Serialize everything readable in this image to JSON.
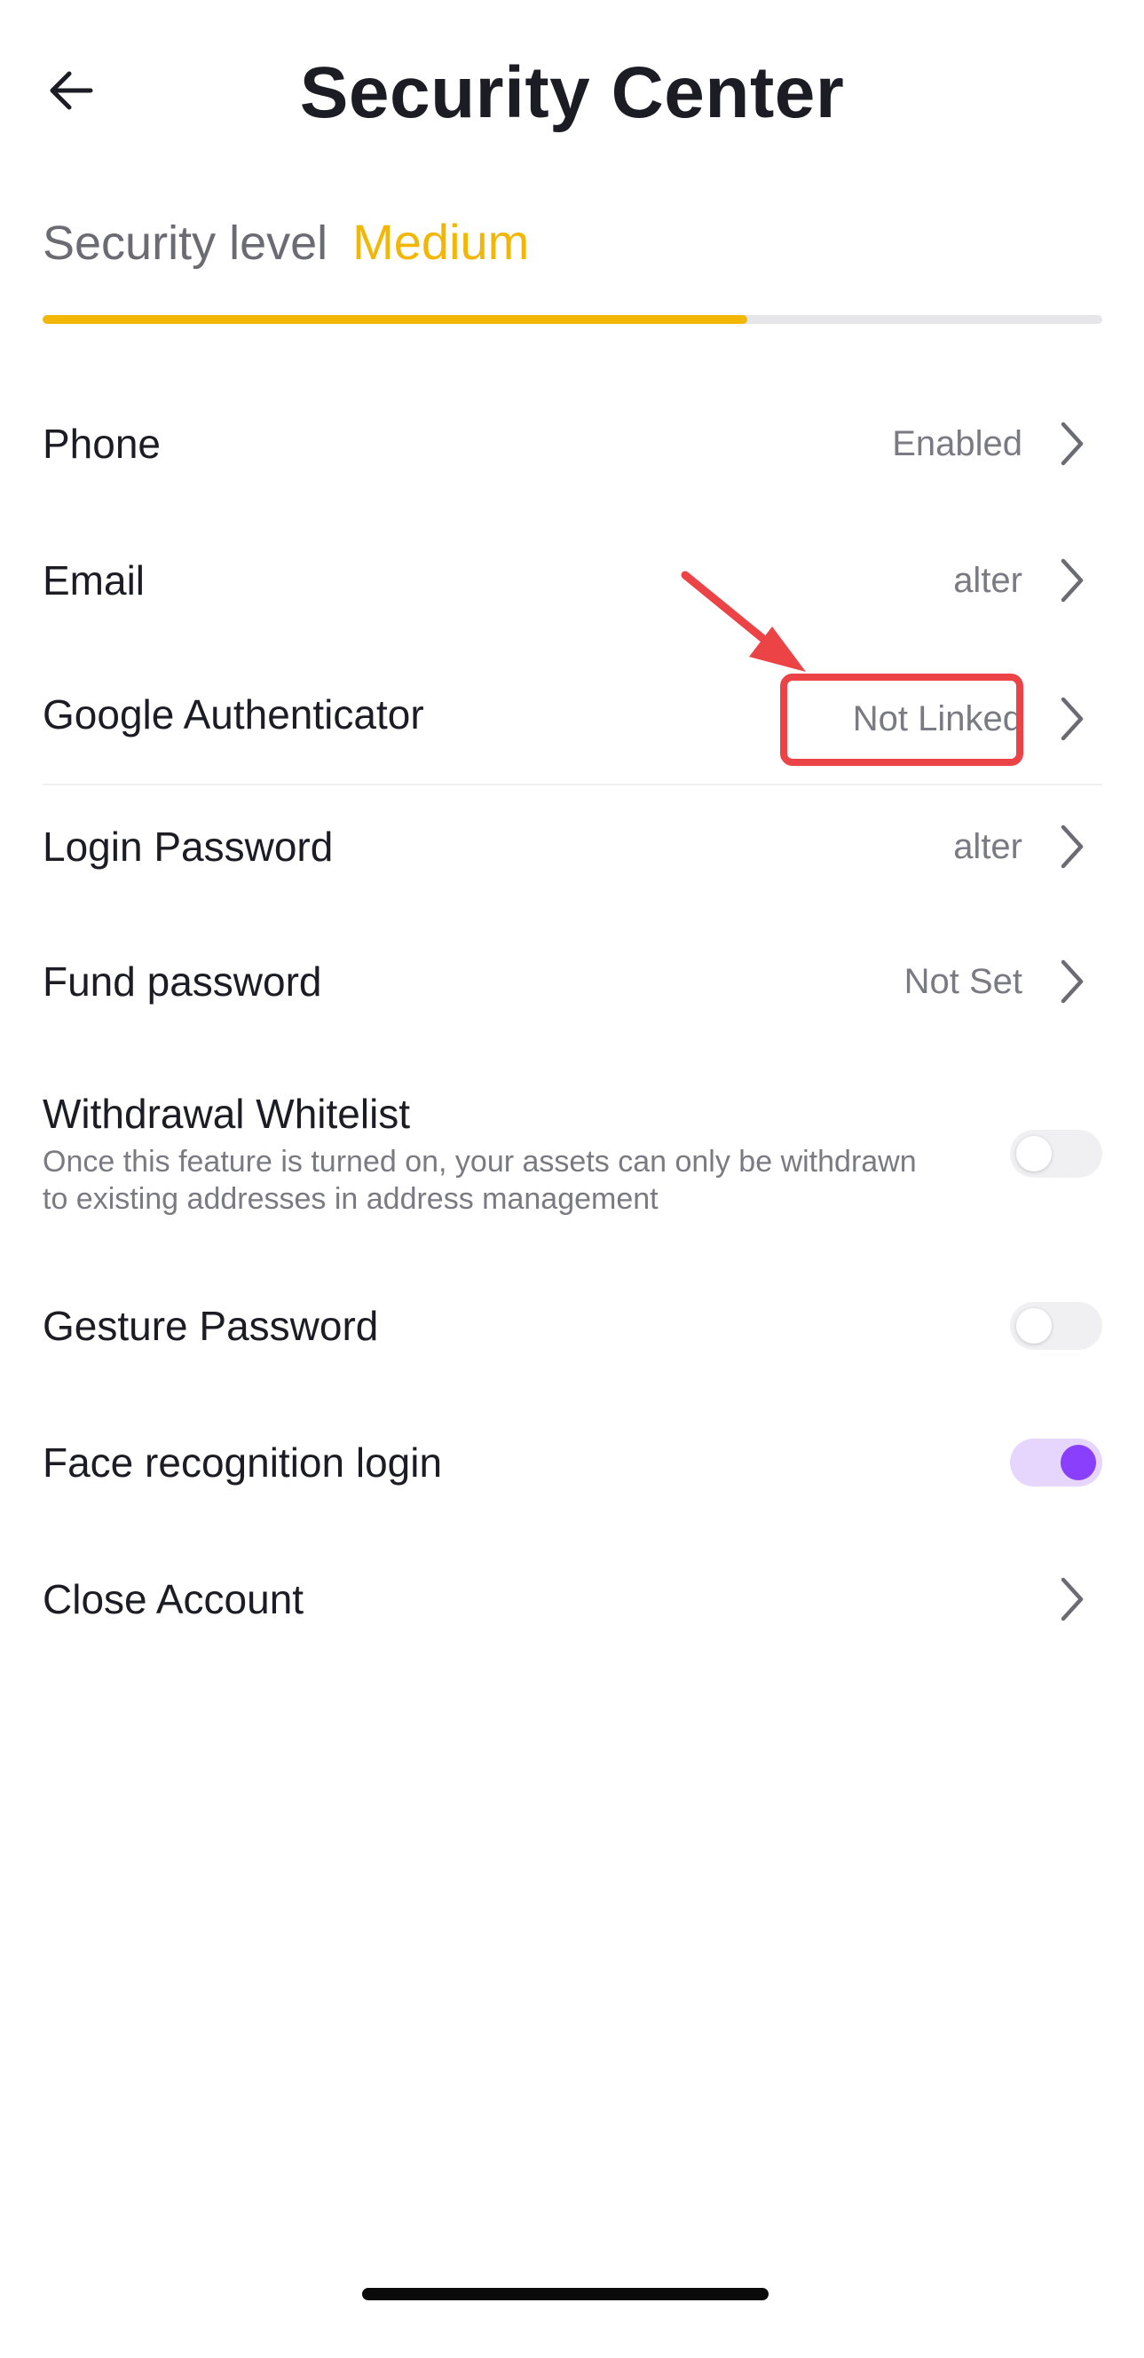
{
  "header": {
    "title": "Security Center",
    "back_icon": "arrow-left-icon"
  },
  "security_level": {
    "label": "Security level",
    "value": "Medium",
    "progress": 0.665,
    "colors": {
      "accent": "#f2b705",
      "track": "#e6e6e8"
    }
  },
  "items": [
    {
      "label": "Phone",
      "value": "Enabled"
    },
    {
      "label": "Email",
      "value": "alter"
    },
    {
      "label": "Google Authenticator",
      "value": "Not Linked"
    },
    {
      "label": "Login Password",
      "value": "alter"
    },
    {
      "label": "Fund password",
      "value": "Not Set"
    }
  ],
  "toggles": [
    {
      "label": "Withdrawal Whitelist",
      "description": "Once this feature is turned on, your assets can only be withdrawn to existing addresses in address management",
      "enabled": false
    },
    {
      "label": "Gesture Password",
      "enabled": false
    },
    {
      "label": "Face recognition login",
      "enabled": true
    }
  ],
  "close_account": {
    "label": "Close Account"
  },
  "annotation": {
    "color": "#ec4347"
  },
  "colors": {
    "toggle_on_track": "#e6d6fd",
    "toggle_on_knob": "#8a3ffc",
    "toggle_off_track": "#f0f0f2"
  }
}
